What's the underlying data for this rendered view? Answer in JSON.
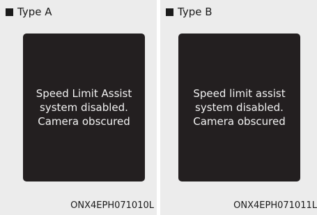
{
  "panels": [
    {
      "type_label": "Type A",
      "message_lines": [
        "Speed Limit Assist",
        "system disabled.",
        "Camera obscured"
      ],
      "code": "ONX4EPH071010L"
    },
    {
      "type_label": "Type B",
      "message_lines": [
        "Speed limit assist",
        "system disabled.",
        "Camera obscured"
      ],
      "code": "ONX4EPH071011L"
    }
  ],
  "colors": {
    "panel_background": "#ececec",
    "screen_background": "#231f20",
    "screen_text": "#f2f2f2"
  }
}
